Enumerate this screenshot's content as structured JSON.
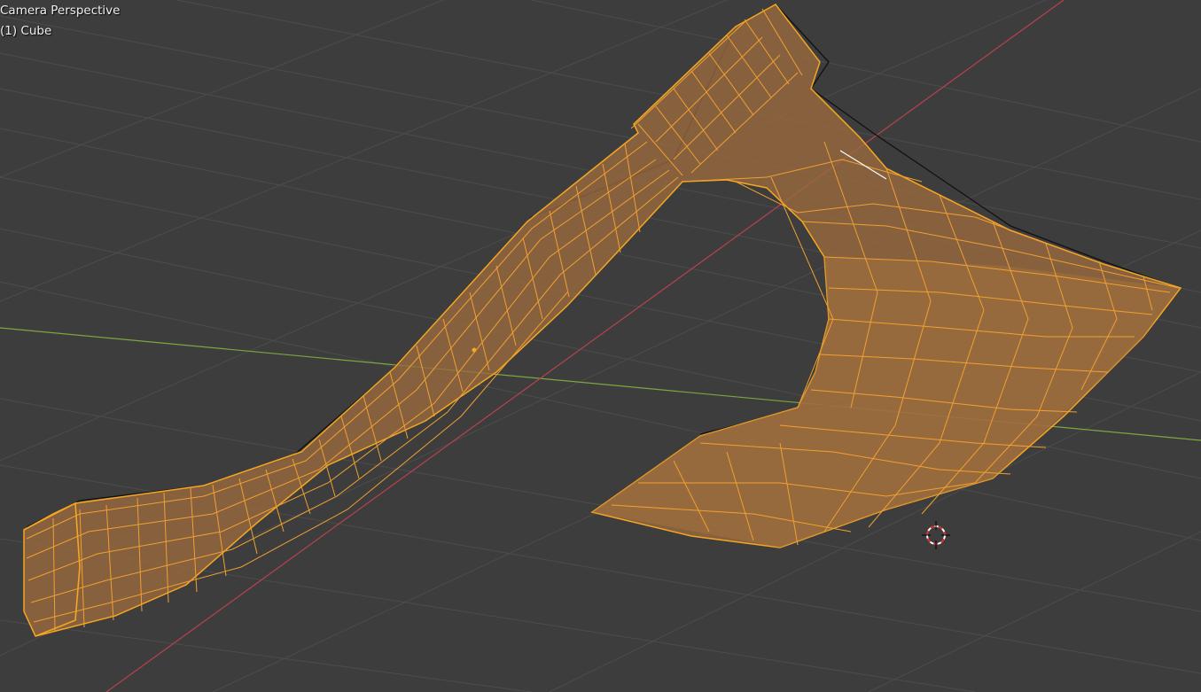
{
  "viewport": {
    "view_name": "Camera Perspective",
    "object_label": "(1) Cube",
    "colors": {
      "background": "#3d3d3d",
      "grid": "#4c4c4c",
      "x_axis": "#b5434f",
      "y_axis": "#7ea63f",
      "selection": "#f5a623",
      "face_fill": "#9a6a3e"
    },
    "icons": {
      "cursor": "3d-cursor-icon",
      "origin": "object-origin-icon"
    }
  }
}
